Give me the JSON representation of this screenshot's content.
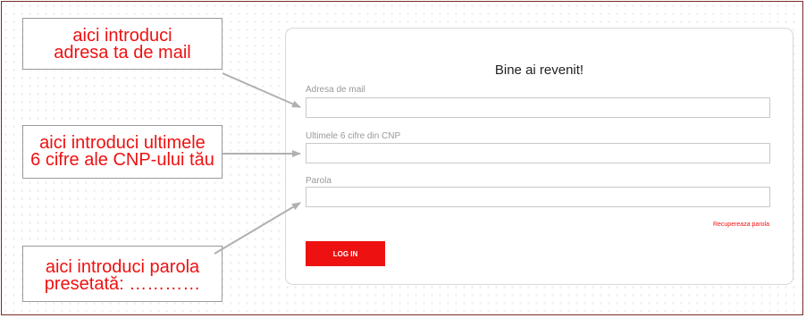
{
  "login_card": {
    "title": "Bine ai revenit!",
    "email_label": "Adresa de mail",
    "email_value": "",
    "cnp_label": "Ultimele 6 cifre din CNP",
    "cnp_value": "",
    "password_label": "Parola",
    "password_value": "",
    "recover_link": "Recupereaza parola",
    "login_button": "LOG IN"
  },
  "annotations": {
    "email": {
      "line1": "aici introduci",
      "line2": "adresa ta de mail"
    },
    "cnp": {
      "line1": "aici introduci ultimele",
      "line2": "6 cifre ale CNP-ului tău"
    },
    "password": {
      "line1": "aici introduci parola",
      "line2": "presetată: …………"
    }
  },
  "colors": {
    "accent": "#ee1111",
    "frame_border": "#7a2a2a",
    "arrow": "#b0b0b0"
  }
}
